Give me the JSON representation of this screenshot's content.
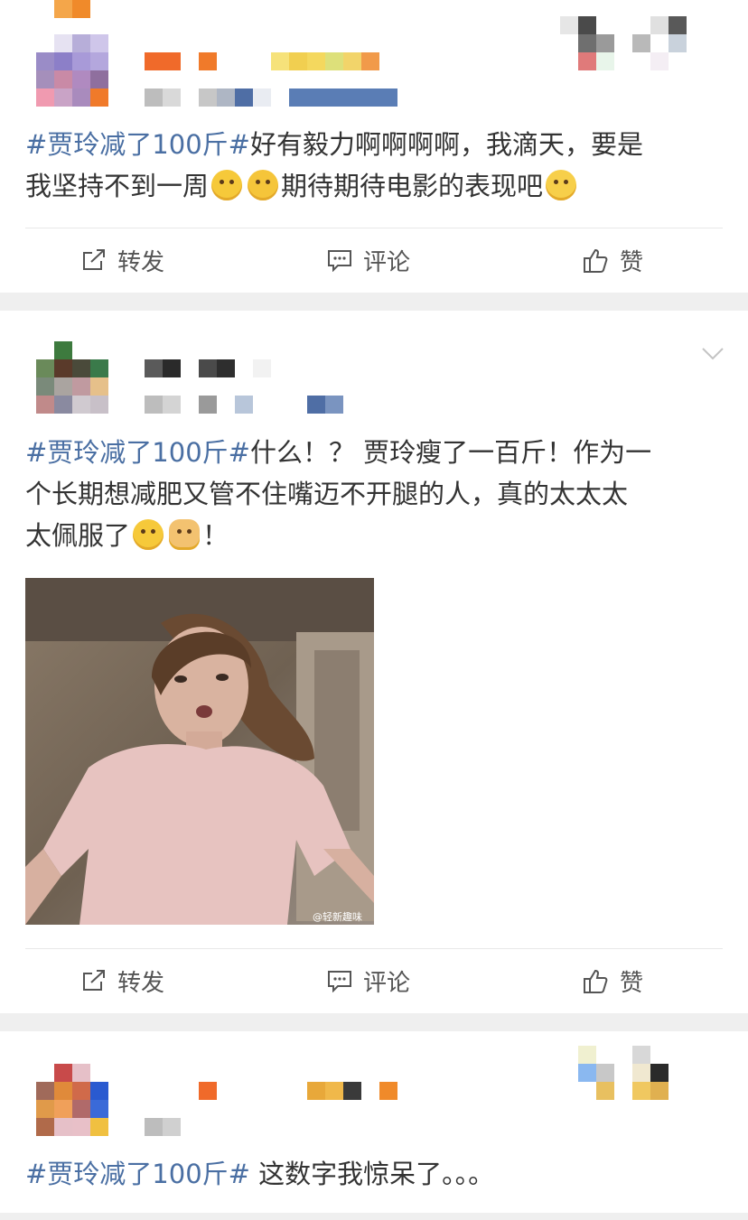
{
  "feed": {
    "posts": [
      {
        "hashtag": "#贾玲减了100斤#",
        "text_line1": "好有毅力啊啊啊啊，我滴天，要是",
        "text_line2_a": "我坚持不到一周",
        "text_line2_b": "期待期待电影的表现吧",
        "emojis": [
          "crying-face-icon",
          "laughing-tears-icon",
          "yum-face-icon"
        ]
      },
      {
        "hashtag": "#贾玲减了100斤#",
        "text_line1": "什么！？ 贾玲瘦了一百斤！作为一",
        "text_line2": "个长期想减肥又管不住嘴迈不开腿的人，真的太太太",
        "text_line3_a": "太佩服了",
        "text_line3_b": "！",
        "emojis": [
          "relieved-face-icon",
          "kneeling-person-icon"
        ],
        "photo_watermark": "@轻新趣味"
      },
      {
        "hashtag": "#贾玲减了100斤#",
        "text": " 这数字我惊呆了。。。"
      }
    ],
    "actions": {
      "repost": "转发",
      "comment": "评论",
      "like": "赞"
    }
  },
  "colors": {
    "hashtag": "#4a6fa3",
    "text": "#333333",
    "action_text": "#555555",
    "separator": "#efefef"
  }
}
